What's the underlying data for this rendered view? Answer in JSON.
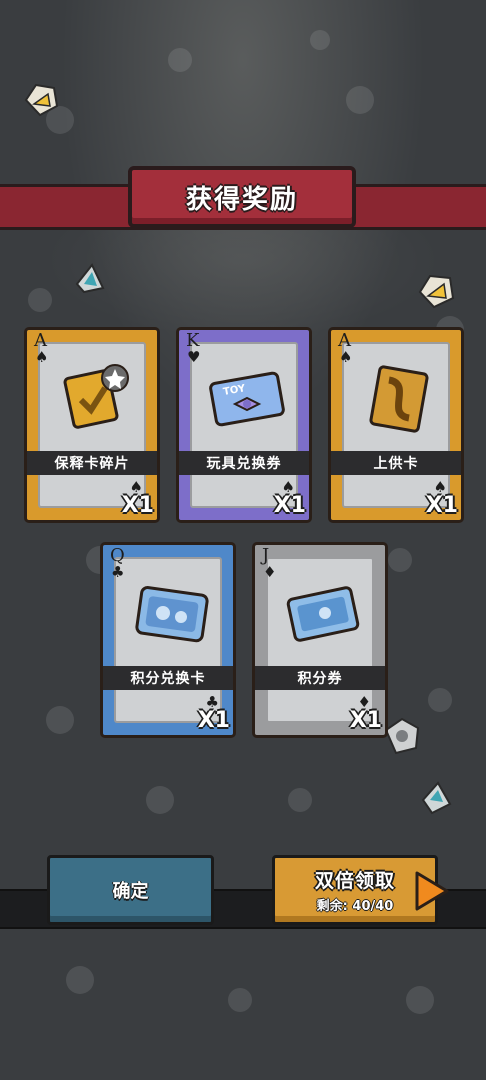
{
  "title": "获得奖励",
  "cards": [
    {
      "rank": "A",
      "suit": "♠",
      "label": "保释卡碎片",
      "qty": "X1",
      "theme": "gold",
      "icon": "badge-fragment-icon"
    },
    {
      "rank": "K",
      "suit": "♥",
      "label": "玩具兑换券",
      "qty": "X1",
      "theme": "purple",
      "icon": "toy-ticket-icon"
    },
    {
      "rank": "A",
      "suit": "♠",
      "label": "上供卡",
      "qty": "X1",
      "theme": "gold",
      "icon": "offering-card-icon"
    },
    {
      "rank": "Q",
      "suit": "♣",
      "label": "积分兑换卡",
      "qty": "X1",
      "theme": "blue",
      "icon": "points-exchange-card-icon"
    },
    {
      "rank": "J",
      "suit": "♦",
      "label": "积分券",
      "qty": "X1",
      "theme": "gray",
      "icon": "points-ticket-icon"
    }
  ],
  "buttons": {
    "confirm": "确定",
    "double": "双倍领取",
    "remaining": "剩余: 40/40"
  },
  "colors": {
    "gold": "#d99a2c",
    "purple": "#7d6ec9",
    "blue": "#4f88c9",
    "gray": "#9b9c9e",
    "banner": "#a32f3b",
    "confirm": "#3c6f87",
    "double": "#d89a34"
  }
}
